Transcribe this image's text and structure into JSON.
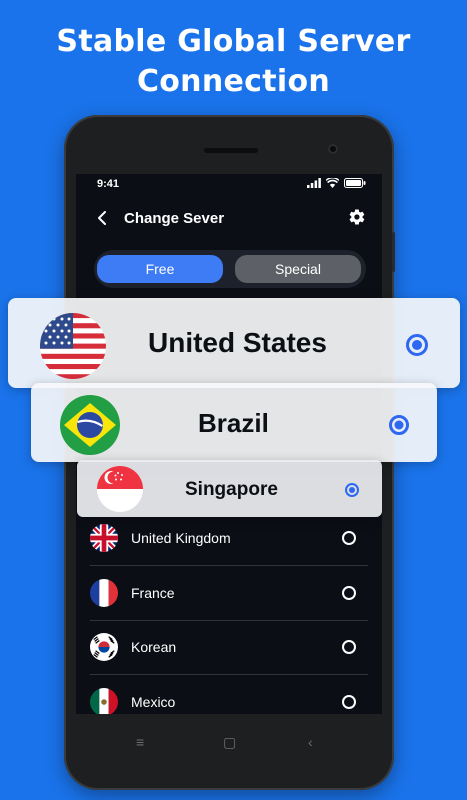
{
  "headline": {
    "line1": "Stable Global Server",
    "line2": "Connection"
  },
  "status_bar": {
    "time": "9:41"
  },
  "header": {
    "title": "Change Sever"
  },
  "tabs": [
    {
      "label": "Free",
      "selected": true
    },
    {
      "label": "Special",
      "selected": false
    }
  ],
  "highlighted_servers": [
    {
      "country": "United States",
      "flag_icon": "us-flag-icon",
      "selected": true
    },
    {
      "country": "Brazil",
      "flag_icon": "brazil-flag-icon",
      "selected": true
    },
    {
      "country": "Singapore",
      "flag_icon": "singapore-flag-icon",
      "selected": true
    }
  ],
  "servers": [
    {
      "country": "United Kingdom",
      "flag_icon": "uk-flag-icon"
    },
    {
      "country": "France",
      "flag_icon": "france-flag-icon"
    },
    {
      "country": "Korean",
      "flag_icon": "korea-flag-icon"
    },
    {
      "country": "Mexico",
      "flag_icon": "mexico-flag-icon"
    }
  ],
  "colors": {
    "background": "#1a73ea",
    "accent": "#3d7cf5",
    "screen": "#0b0e15",
    "radio_selected": "#2d67f2"
  }
}
